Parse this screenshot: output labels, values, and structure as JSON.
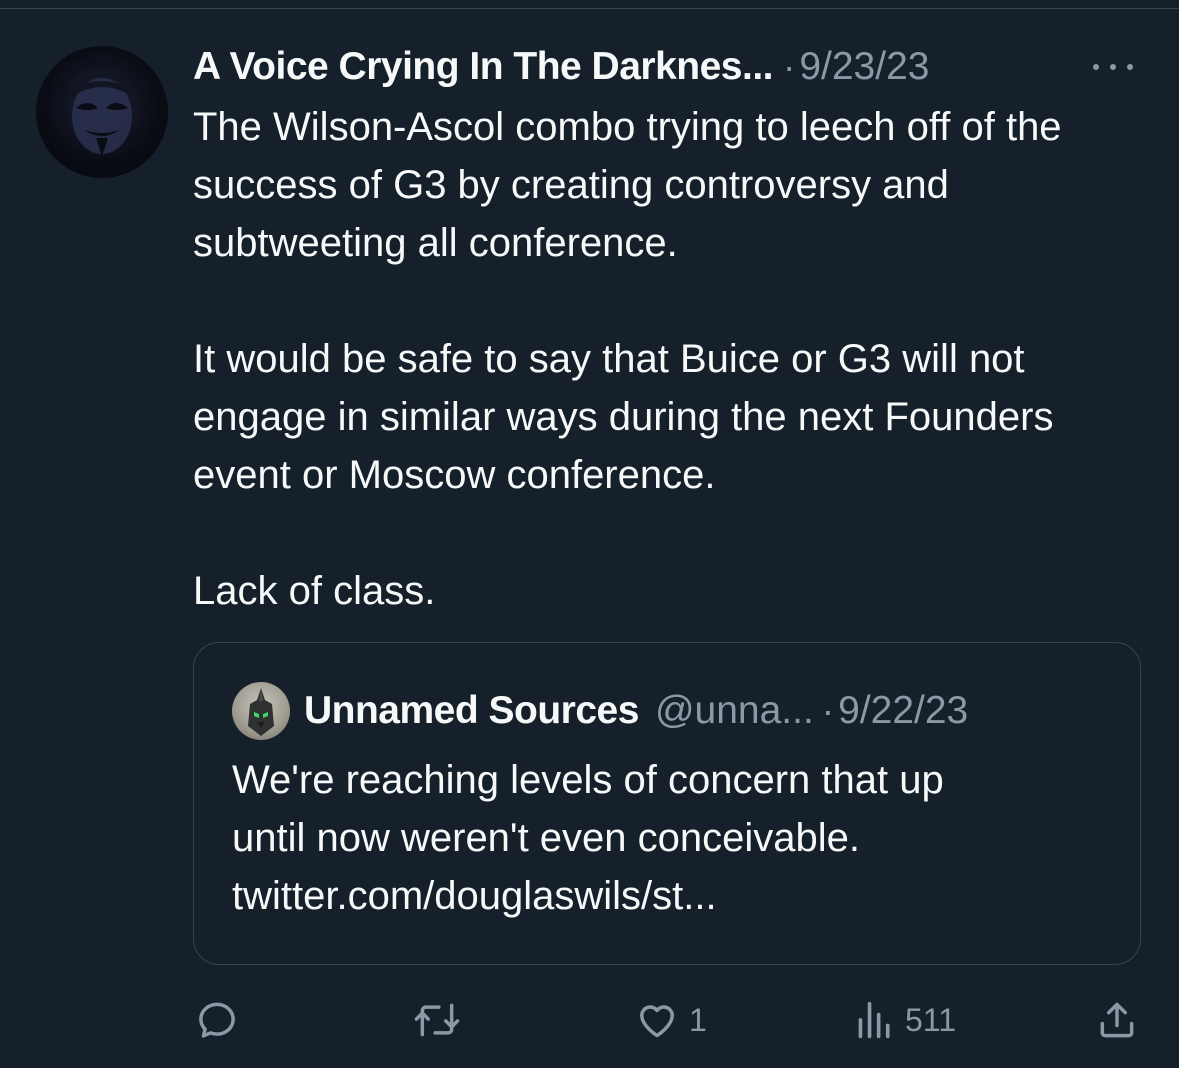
{
  "tweet": {
    "author_name": "A Voice Crying In The Darknes...",
    "separator": "·",
    "timestamp": "9/23/23",
    "paragraphs": [
      "The Wilson-Ascol combo trying to leech off of the success of G3 by creating controversy and subtweeting all conference.",
      "It would be safe to say that Buice or G3 will not engage in similar ways during the next Founders event or Moscow conference.",
      "Lack of class."
    ]
  },
  "quote": {
    "author_name": "Unnamed Sources",
    "handle": "@unna...",
    "separator": "·",
    "timestamp": "9/22/23",
    "lines": [
      "We're reaching levels of concern that up",
      "until now weren't even conceivable.",
      "twitter.com/douglaswils/st..."
    ]
  },
  "actions": {
    "reply_icon": "reply-icon",
    "retweet_icon": "retweet-icon",
    "like_icon": "like-icon",
    "like_count": "1",
    "views_icon": "views-icon",
    "views_count": "511",
    "share_icon": "share-icon"
  },
  "colors": {
    "background": "#15202b",
    "text_primary": "#f7f9f9",
    "text_secondary": "#8b98a5",
    "border": "#38444d"
  }
}
